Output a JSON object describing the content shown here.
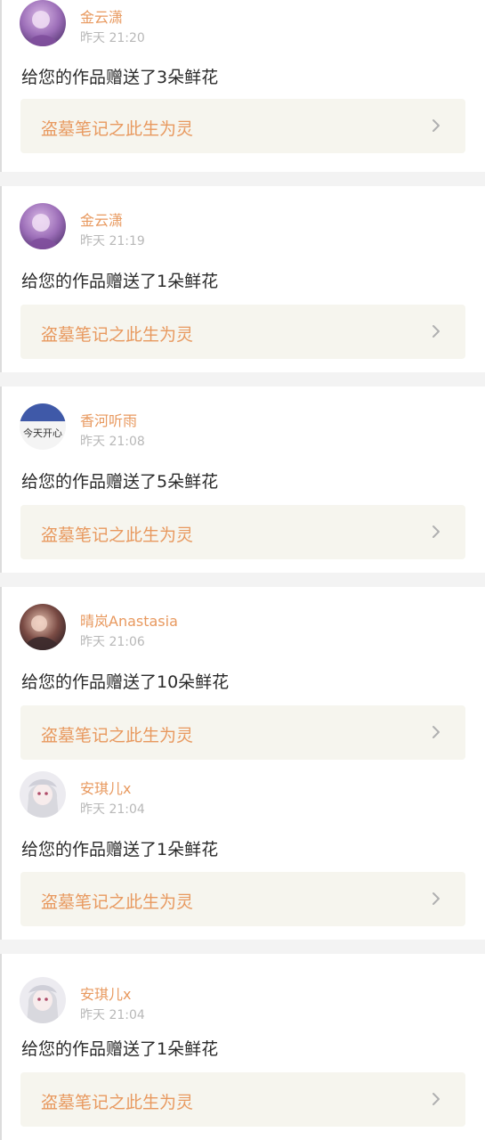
{
  "notifications": [
    {
      "user_name": "金云潇",
      "time": "昨天 21:20",
      "message": "给您的作品赠送了3朵鲜花",
      "work_title": "盗墓笔记之此生为灵",
      "avatar_icon": "purple-portrait-avatar"
    },
    {
      "user_name": "金云潇",
      "time": "昨天 21:19",
      "message": "给您的作品赠送了1朵鲜花",
      "work_title": "盗墓笔记之此生为灵",
      "avatar_icon": "purple-portrait-avatar"
    },
    {
      "user_name": "香河听雨",
      "time": "昨天 21:08",
      "message": "给您的作品赠送了5朵鲜花",
      "work_title": "盗墓笔记之此生为灵",
      "avatar_icon": "blue-banner-avatar"
    },
    {
      "user_name": "晴岚Anastasia",
      "time": "昨天 21:06",
      "message": "给您的作品赠送了10朵鲜花",
      "work_title": "盗墓笔记之此生为灵",
      "avatar_icon": "dark-portrait-avatar"
    },
    {
      "user_name": "安琪儿x",
      "time": "昨天 21:04",
      "message": "给您的作品赠送了1朵鲜花",
      "work_title": "盗墓笔记之此生为灵",
      "avatar_icon": "white-hair-anime-avatar"
    },
    {
      "user_name": "安琪儿x",
      "time": "昨天 21:04",
      "message": "给您的作品赠送了1朵鲜花",
      "work_title": "盗墓笔记之此生为灵",
      "avatar_icon": "white-hair-anime-avatar"
    }
  ],
  "colors": {
    "accent": "#e8995f",
    "muted": "#b8b8b8",
    "link_bg": "#f6f5ee",
    "page_bg": "#f3f3f3"
  }
}
